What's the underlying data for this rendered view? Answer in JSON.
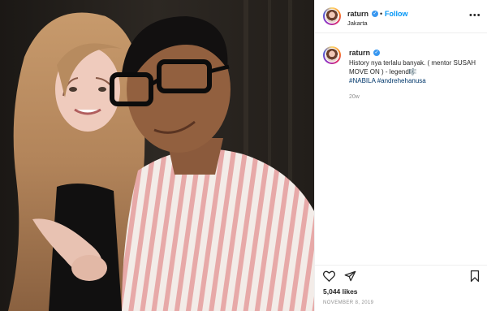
{
  "post": {
    "username": "raturn",
    "follow_label": "Follow",
    "separator": "•",
    "location": "Jakarta",
    "more_label": "•••",
    "caption": {
      "username": "raturn",
      "text": "History nya terlalu banyak. ( mentor SUSAH MOVE ON ) - legend🎼",
      "hashtags": "#NABILA #andrehehanusa",
      "age": "20w"
    },
    "likes": "5,044 likes",
    "date": "NOVEMBER 8, 2019"
  },
  "icons": {
    "verified": "verified-badge-icon",
    "like": "heart-icon",
    "share": "paper-plane-icon",
    "save": "bookmark-icon"
  },
  "colors": {
    "follow_blue": "#0095f6",
    "verified_blue": "#3897f0",
    "hashtag_blue": "#00376b",
    "text": "#262626",
    "muted": "#8e8e8e"
  }
}
